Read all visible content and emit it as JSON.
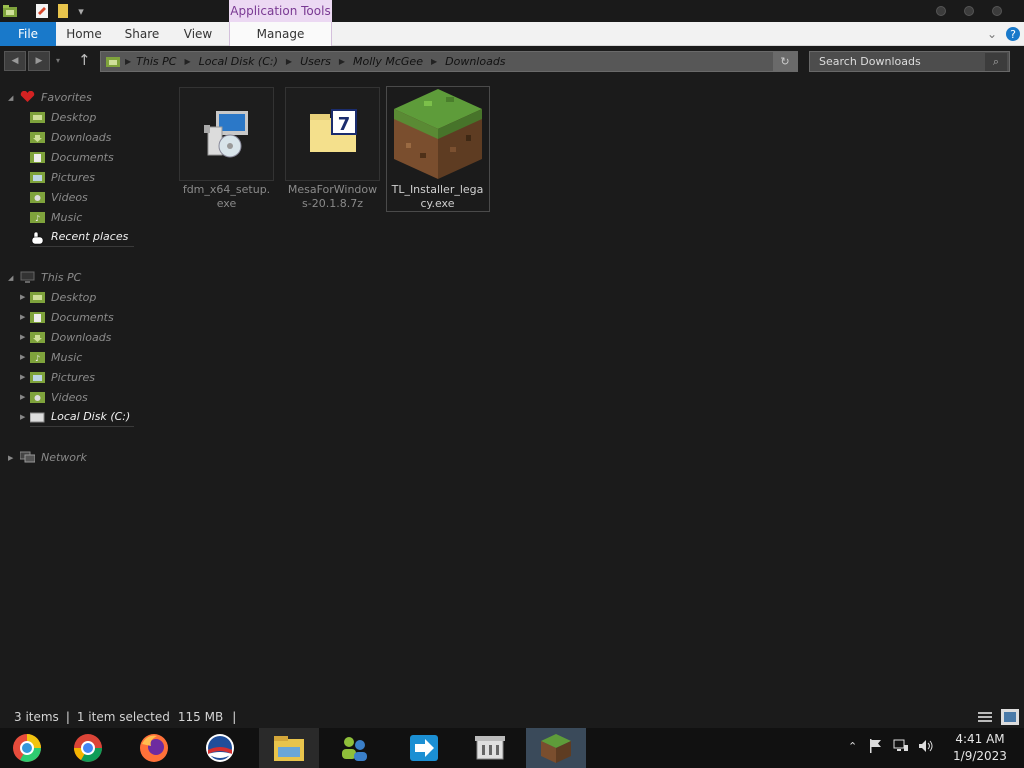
{
  "window": {
    "context_tab": "Application Tools",
    "ribbon_tabs": {
      "file": "File",
      "home": "Home",
      "share": "Share",
      "view": "View",
      "manage": "Manage"
    }
  },
  "address": {
    "crumbs": [
      "This PC",
      "Local Disk (C:)",
      "Users",
      "Molly McGee",
      "Downloads"
    ],
    "search_placeholder": "Search Downloads"
  },
  "nav": {
    "favorites": {
      "label": "Favorites",
      "items": [
        "Desktop",
        "Downloads",
        "Documents",
        "Pictures",
        "Videos",
        "Music",
        "Recent places"
      ]
    },
    "this_pc": {
      "label": "This PC",
      "items": [
        "Desktop",
        "Documents",
        "Downloads",
        "Music",
        "Pictures",
        "Videos",
        "Local Disk (C:)"
      ]
    },
    "network": {
      "label": "Network"
    }
  },
  "files": [
    {
      "name": "fdm_x64_setup.exe",
      "icon": "installer-icon"
    },
    {
      "name": "MesaForWindows-20.1.8.7z",
      "icon": "7zip-archive-icon"
    },
    {
      "name": "TL_Installer_legacy.exe",
      "icon": "minecraft-grass-block-icon",
      "selected": true
    }
  ],
  "status": {
    "items": "3 items",
    "selected": "1 item selected",
    "size": "115 MB"
  },
  "taskbar": {
    "apps": [
      "chrome-alt-icon",
      "chrome-icon",
      "firefox-icon",
      "obama-logo-icon",
      "file-explorer-icon",
      "network-people-icon",
      "teamviewer-arrow-icon",
      "archive-box-icon",
      "minecraft-icon"
    ],
    "time": "4:41 AM",
    "date": "1/9/2023"
  },
  "colors": {
    "file_tab": "#1979ca",
    "context_tab_bg": "#ecd9f3",
    "context_tab_text": "#7a3a93",
    "folder_green": "#7fa33c"
  }
}
